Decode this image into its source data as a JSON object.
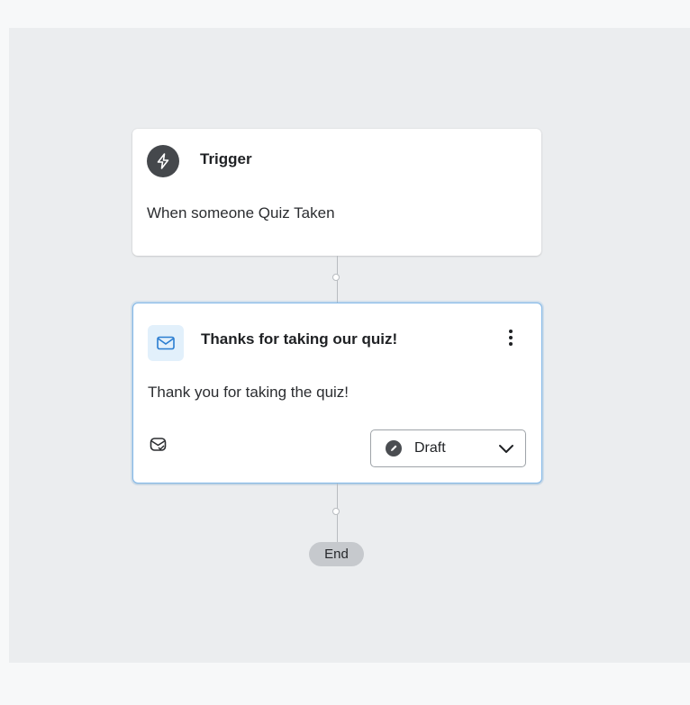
{
  "trigger": {
    "icon": "lightning-bolt-icon",
    "title": "Trigger",
    "description": "When someone Quiz Taken"
  },
  "action": {
    "icon": "email-envelope-icon",
    "title": "Thanks for taking our quiz!",
    "description": "Thank you for taking the quiz!",
    "menu_icon": "more-vertical-icon",
    "type_icon": "email-check-icon",
    "status": {
      "value": "Draft",
      "icon": "draft-status-icon",
      "dropdown_icon": "chevron-down-icon"
    }
  },
  "end": {
    "label": "End"
  },
  "colors": {
    "canvas": "#ebedef",
    "accent_border": "#7fb6e8",
    "email_icon_bg": "#e2f0fb",
    "email_icon": "#2a7dd1",
    "trigger_icon_bg": "#45484c"
  }
}
